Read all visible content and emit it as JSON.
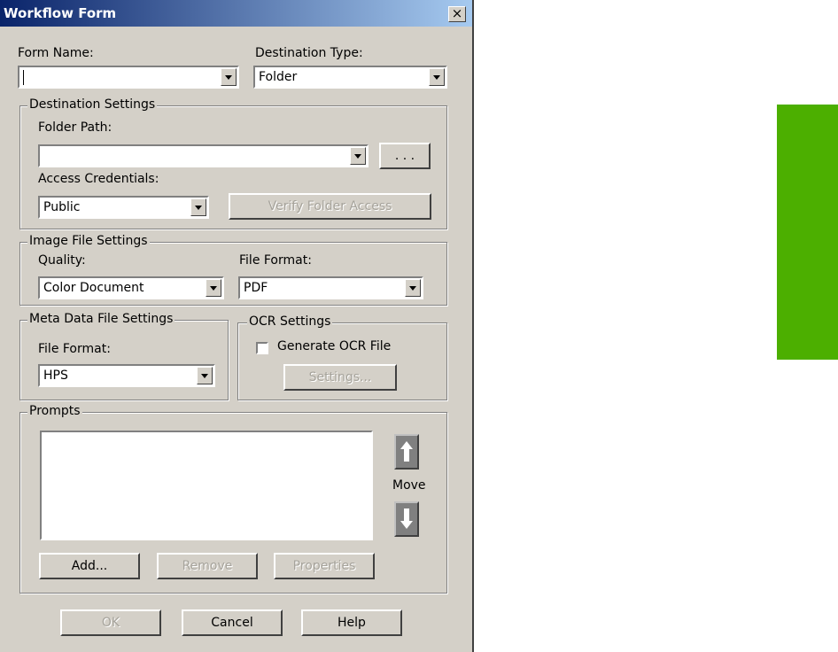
{
  "window": {
    "title": "Workflow Form",
    "close_label": "×"
  },
  "form_name": {
    "label": "Form Name:",
    "value": ""
  },
  "destination_type": {
    "label": "Destination Type:",
    "value": "Folder"
  },
  "destination_settings": {
    "title": "Destination Settings",
    "folder_path_label": "Folder Path:",
    "folder_path_value": "",
    "browse_label": ". . .",
    "access_credentials_label": "Access Credentials:",
    "access_credentials_value": "Public",
    "verify_label": "Verify Folder Access"
  },
  "image_file_settings": {
    "title": "Image File Settings",
    "quality_label": "Quality:",
    "quality_value": "Color Document",
    "file_format_label": "File Format:",
    "file_format_value": "PDF"
  },
  "meta_data_settings": {
    "title": "Meta Data File Settings",
    "file_format_label": "File Format:",
    "file_format_value": "HPS"
  },
  "ocr_settings": {
    "title": "OCR Settings",
    "generate_label": "Generate OCR File",
    "generate_checked": false,
    "settings_label": "Settings..."
  },
  "prompts": {
    "title": "Prompts",
    "move_label": "Move",
    "add_label": "Add...",
    "remove_label": "Remove",
    "properties_label": "Properties"
  },
  "footer": {
    "ok_label": "OK",
    "cancel_label": "Cancel",
    "help_label": "Help"
  },
  "colors": {
    "accent_bar": "#4caf00",
    "titlebar": "#0a246a",
    "dialog_bg": "#d4d0c8"
  }
}
